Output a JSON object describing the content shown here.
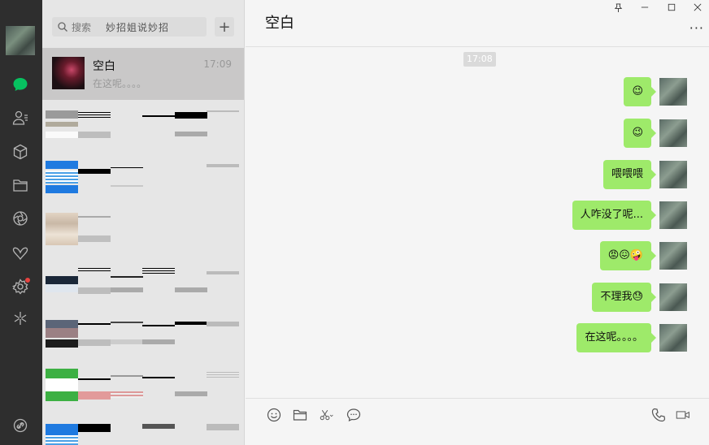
{
  "sidebar": {
    "icons": [
      "chat-icon",
      "contacts-icon",
      "box-icon",
      "folder-icon",
      "aperture-icon",
      "butterfly-icon",
      "settings-icon",
      "sparkle-icon",
      "link-icon"
    ]
  },
  "list": {
    "search_placeholder": "搜索",
    "search_hint": "妙招姐说妙招",
    "plus_label": "+",
    "active_chat": {
      "name": "空白",
      "time": "17:09",
      "preview": "在这呢。。。。"
    }
  },
  "chat": {
    "title": "空白",
    "more_label": "···",
    "timestamp": "17:08",
    "messages": [
      {
        "text": "😉"
      },
      {
        "text": "😉"
      },
      {
        "text": "喂喂喂"
      },
      {
        "text": "人咋没了呢..."
      },
      {
        "text": "😡😖🤪"
      },
      {
        "text": "不理我😓"
      },
      {
        "text": "在这呢。。。。"
      }
    ]
  },
  "window": {
    "pin_label": "📌",
    "min_label": "─",
    "max_label": "☐",
    "close_label": "✕"
  },
  "colors": {
    "rail_bg": "#2e2e2e",
    "list_bg": "#e6e6e6",
    "bubble": "#9eea6a",
    "chat_active": "#07c160"
  }
}
